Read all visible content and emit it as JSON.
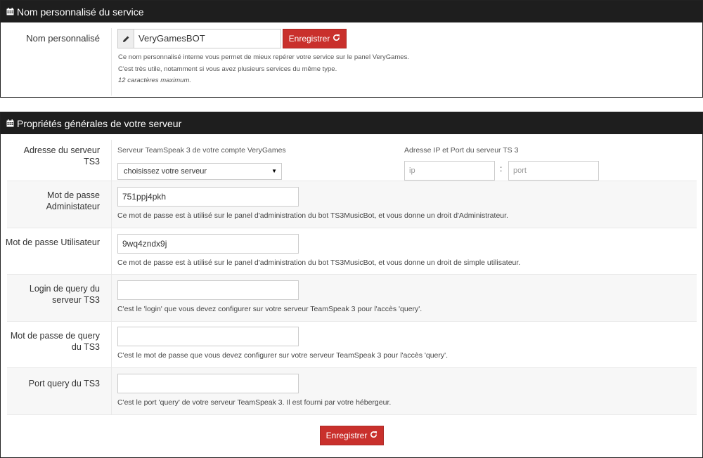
{
  "panel1": {
    "title": "Nom personnalisé du service",
    "label": "Nom personnalisé",
    "name_value": "VeryGamesBOT",
    "save_label": "Enregistrer",
    "help_1": "Ce nom personnalisé interne vous permet de mieux repérer votre service sur le panel VeryGames.",
    "help_2": "C'est très utile, notamment si vous avez plusieurs services du même type.",
    "help_3": "12 caractères maximum."
  },
  "panel2": {
    "title": "Propriétés générales de votre serveur",
    "server": {
      "label": "Adresse du serveur TS3",
      "account_label": "Serveur TeamSpeak 3 de votre compte VeryGames",
      "select_value": "choisissez votre serveur",
      "ipport_label": "Adresse IP et Port du serveur TS 3",
      "ip_placeholder": "ip",
      "port_placeholder": "port",
      "colon": ":"
    },
    "admin_pw": {
      "label_1": "Mot de passe",
      "label_2": "Administateur",
      "value": "751ppj4pkh",
      "help": "Ce mot de passe est à utilisé sur le panel d'administration du bot TS3MusicBot, et vous donne un droit d'Administrateur."
    },
    "user_pw": {
      "label": "Mot de passe Utilisateur",
      "value": "9wq4zndx9j",
      "help": "Ce mot de passe est à utilisé sur le panel d'administration du bot TS3MusicBot, et vous donne un droit de simple utilisateur."
    },
    "query_login": {
      "label_1": "Login de query du",
      "label_2": "serveur TS3",
      "value": "",
      "help": "C'est le 'login' que vous devez configurer sur votre serveur TeamSpeak 3 pour l'accès 'query'."
    },
    "query_pw": {
      "label_1": "Mot de passe de query",
      "label_2": "du TS3",
      "value": "",
      "help": "C'est le mot de passe que vous devez configurer sur votre serveur TeamSpeak 3 pour l'accès 'query'."
    },
    "query_port": {
      "label": "Port query du TS3",
      "value": "",
      "help": "C'est le port 'query' de votre serveur TeamSpeak 3. Il est fourni par votre hébergeur."
    },
    "save_label": "Enregistrer"
  },
  "colors": {
    "header_bg": "#1e1e1e",
    "button_red": "#c9302c"
  },
  "icons": [
    "calendar-icon",
    "pencil-icon",
    "refresh-icon",
    "caret-down-icon"
  ]
}
